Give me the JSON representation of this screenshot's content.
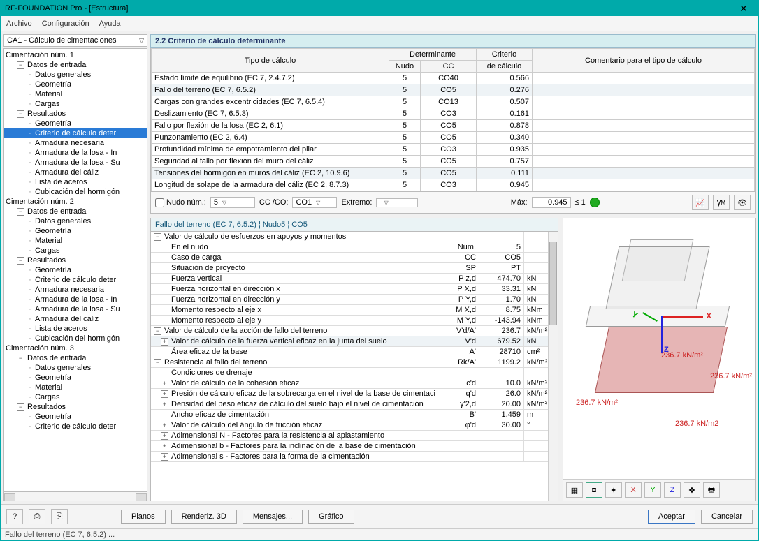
{
  "window": {
    "title": "RF-FOUNDATION Pro - [Estructura]",
    "close": "✕"
  },
  "menu": {
    "archivo": "Archivo",
    "config": "Configuración",
    "ayuda": "Ayuda"
  },
  "sidebar_selector": "CA1 - Cálculo de cimentaciones",
  "tree": {
    "c1": "Cimentación núm. 1",
    "datos": "Datos de entrada",
    "dg": "Datos generales",
    "geo": "Geometría",
    "mat": "Material",
    "car": "Cargas",
    "res": "Resultados",
    "r_geo": "Geometría",
    "r_crit": "Criterio de cálculo deter",
    "r_arm": "Armadura necesaria",
    "r_al1": "Armadura de la losa - In",
    "r_al2": "Armadura de la losa - Su",
    "r_ac": "Armadura del cáliz",
    "r_la": "Lista de aceros",
    "r_ch": "Cubicación del hormigón",
    "c2": "Cimentación núm. 2",
    "c3": "Cimentación núm. 3"
  },
  "section_title": "2.2 Criterio de cálculo determinante",
  "headers": {
    "tipo": "Tipo de cálculo",
    "det": "Determinante",
    "nudo": "Nudo",
    "cc": "CC",
    "crit": "Criterio",
    "dc": "de cálculo",
    "com": "Comentario para el tipo de cálculo"
  },
  "rows": [
    {
      "tipo": "Estado límite de equilibrio (EC 7, 2.4.7.2)",
      "nudo": "5",
      "cc": "CO40",
      "crit": "0.566"
    },
    {
      "tipo": "Fallo del terreno (EC 7, 6.5.2)",
      "nudo": "5",
      "cc": "CO5",
      "crit": "0.276",
      "hl": true
    },
    {
      "tipo": "Cargas con grandes excentricidades (EC 7, 6.5.4)",
      "nudo": "5",
      "cc": "CO13",
      "crit": "0.507"
    },
    {
      "tipo": "Deslizamiento (EC 7, 6.5.3)",
      "nudo": "5",
      "cc": "CO3",
      "crit": "0.161"
    },
    {
      "tipo": "Fallo por flexión de la losa (EC 2, 6.1)",
      "nudo": "5",
      "cc": "CO5",
      "crit": "0.878"
    },
    {
      "tipo": "Punzonamiento (EC 2, 6.4)",
      "nudo": "5",
      "cc": "CO5",
      "crit": "0.340"
    },
    {
      "tipo": "Profundidad mínima de empotramiento del pilar",
      "nudo": "5",
      "cc": "CO3",
      "crit": "0.935"
    },
    {
      "tipo": "Seguridad al fallo por flexión del muro del cáliz",
      "nudo": "5",
      "cc": "CO5",
      "crit": "0.757"
    },
    {
      "tipo": "Tensiones del hormigón en muros del cáliz (EC 2, 10.9.6)",
      "nudo": "5",
      "cc": "CO5",
      "crit": "0.111",
      "hl": true
    },
    {
      "tipo": "Longitud de solape de la armadura del cáliz (EC 2, 8.7.3)",
      "nudo": "5",
      "cc": "CO3",
      "crit": "0.945"
    }
  ],
  "filter": {
    "nudo_lbl": "Nudo núm.:",
    "nudo_val": "5",
    "cc_lbl": "CC /CO:",
    "cc_val": "CO1",
    "ext_lbl": "Extremo:",
    "max_lbl": "Máx:",
    "max_val": "0.945",
    "max_cond": "≤ 1"
  },
  "details_title": "Fallo del terreno (EC 7, 6.5.2) ¦ Nudo5 ¦ CO5",
  "drows": [
    {
      "pm": "-",
      "lvl": 0,
      "label": "Valor de cálculo de esfuerzos en apoyos y momentos"
    },
    {
      "lvl": 1,
      "label": "En el nudo",
      "sym": "Núm.",
      "val": "5"
    },
    {
      "lvl": 1,
      "label": "Caso de carga",
      "sym": "CC",
      "val": "CO5"
    },
    {
      "lvl": 1,
      "label": "Situación de proyecto",
      "sym": "SP",
      "val": "PT"
    },
    {
      "lvl": 1,
      "label": "Fuerza vertical",
      "sym": "P z,d",
      "val": "474.70",
      "unit": "kN"
    },
    {
      "lvl": 1,
      "label": "Fuerza horizontal en dirección x",
      "sym": "P X,d",
      "val": "33.31",
      "unit": "kN"
    },
    {
      "lvl": 1,
      "label": "Fuerza horizontal en dirección y",
      "sym": "P Y,d",
      "val": "1.70",
      "unit": "kN"
    },
    {
      "lvl": 1,
      "label": "Momento respecto al eje x",
      "sym": "M X,d",
      "val": "8.75",
      "unit": "kNm"
    },
    {
      "lvl": 1,
      "label": "Momento respecto al eje y",
      "sym": "M Y,d",
      "val": "-143.94",
      "unit": "kNm"
    },
    {
      "pm": "-",
      "lvl": 0,
      "label": "Valor de cálculo de la acción de fallo del terreno",
      "sym": "V'd/A'",
      "val": "236.7",
      "unit": "kN/m²"
    },
    {
      "pm": "+",
      "lvl": 1,
      "label": "Valor de cálculo de la fuerza vertical eficaz en la junta del suelo",
      "sym": "V'd",
      "val": "679.52",
      "unit": "kN",
      "sel": true
    },
    {
      "lvl": 1,
      "label": "Área eficaz de la base",
      "sym": "A'",
      "val": "28710",
      "unit": "cm²"
    },
    {
      "pm": "-",
      "lvl": 0,
      "label": "Resistencia al fallo del terreno",
      "sym": "Rk/A'",
      "val": "1199.2",
      "unit": "kN/m²"
    },
    {
      "lvl": 1,
      "label": "Condiciones de drenaje"
    },
    {
      "pm": "+",
      "lvl": 1,
      "label": "Valor de cálculo de la cohesión eficaz",
      "sym": "c'd",
      "val": "10.0",
      "unit": "kN/m²"
    },
    {
      "pm": "+",
      "lvl": 1,
      "label": "Presión de cálculo eficaz de la sobrecarga en el nivel de la base de cimentaci",
      "sym": "q'd",
      "val": "26.0",
      "unit": "kN/m²"
    },
    {
      "pm": "+",
      "lvl": 1,
      "label": "Densidad del peso eficaz de cálculo del suelo bajo el nivel de cimentación",
      "sym": "γ'2,d",
      "val": "20.00",
      "unit": "kN/m³"
    },
    {
      "lvl": 1,
      "label": "Ancho eficaz de cimentación",
      "sym": "B'",
      "val": "1.459",
      "unit": "m"
    },
    {
      "pm": "+",
      "lvl": 1,
      "label": "Valor de cálculo del ángulo de fricción eficaz",
      "sym": "φ'd",
      "val": "30.00",
      "unit": "°"
    },
    {
      "pm": "+",
      "lvl": 1,
      "label": "Adimensional N - Factores para la resistencia al aplastamiento"
    },
    {
      "pm": "+",
      "lvl": 1,
      "label": "Adimensional b - Factores para la inclinación de la base de cimentación"
    },
    {
      "pm": "+",
      "lvl": 1,
      "label": "Adimensional s - Factores para la forma de la cimentación"
    }
  ],
  "viewer_labels": {
    "v": "236.7 kN/m²",
    "bottom": "236.7 kN/m2"
  },
  "footer": {
    "planos": "Planos",
    "render": "Renderiz. 3D",
    "msg": "Mensajes...",
    "graf": "Gráfico",
    "ok": "Aceptar",
    "cancel": "Cancelar"
  },
  "status": "Fallo del terreno (EC 7, 6.5.2) ..."
}
